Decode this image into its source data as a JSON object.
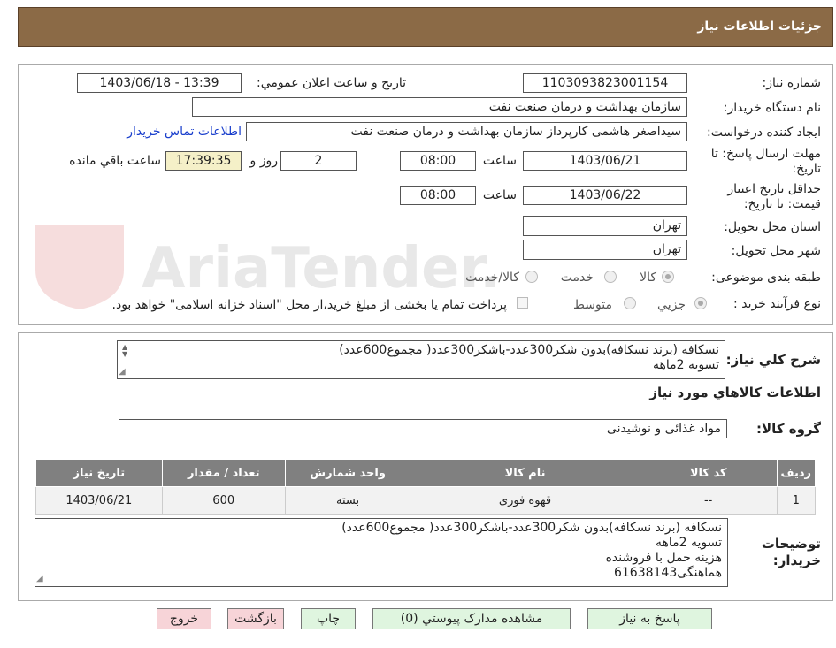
{
  "header": {
    "title": "جزئیات اطلاعات نیاز"
  },
  "form": {
    "need_number_label": "شماره نیاز:",
    "need_number": "1103093823001154",
    "announce_label": "تاریخ و ساعت اعلان عمومي:",
    "announce_value": "1403/06/18 - 13:39",
    "buyer_org_label": "نام دستگاه خریدار:",
    "buyer_org": "سازمان بهداشت و درمان صنعت نفت",
    "requester_label": "ایجاد کننده درخواست:",
    "requester": "سیداصغر هاشمی کارپرداز سازمان بهداشت و درمان صنعت نفت",
    "contact_link": "اطلاعات تماس خریدار",
    "deadline_label_1": "مهلت ارسال پاسخ: تا",
    "deadline_label_2": "تاریخ:",
    "deadline_date": "1403/06/21",
    "time_label": "ساعت",
    "deadline_time": "08:00",
    "days_value": "2",
    "days_label": "روز و",
    "remaining_time": "17:39:35",
    "remaining_label": "ساعت باقي مانده",
    "validity_label_1": "حداقل تاریخ اعتبار",
    "validity_label_2": "قیمت: تا تاریخ:",
    "validity_date": "1403/06/22",
    "validity_time": "08:00",
    "province_label": "استان محل تحویل:",
    "province": "تهران",
    "city_label": "شهر محل تحویل:",
    "city": "تهران",
    "category_label": "طبقه بندی موضوعی:",
    "category_options": [
      "کالا",
      "خدمت",
      "کالا/خدمت"
    ],
    "process_label": "نوع فرآیند خرید :",
    "process_options": [
      "جزیي",
      "متوسط"
    ],
    "payment_note": "پرداخت تمام یا بخشی از مبلغ خرید،از محل \"اسناد خزانه اسلامی\" خواهد بود."
  },
  "summary": {
    "label": "شرح کلي نياز:",
    "lines": [
      "نسکافه (برند نسکافه)بدون شکر300عدد-باشکر300عدد( مجموع600عدد)",
      "تسویه 2ماهه"
    ]
  },
  "goods": {
    "section_title": "اطلاعات کالاهاي مورد نياز",
    "group_label": "گروه کالا:",
    "group_value": "مواد غذائی و نوشیدنی",
    "columns": [
      "ردیف",
      "کد کالا",
      "نام کالا",
      "واحد شمارش",
      "تعداد / مقدار",
      "تاریخ نیاز"
    ],
    "rows": [
      {
        "idx": "1",
        "code": "--",
        "name": "قهوه فوری",
        "unit": "بسته",
        "qty": "600",
        "date": "1403/06/21"
      }
    ]
  },
  "notes": {
    "label_1": "توضیحات",
    "label_2": "خریدار:",
    "lines": [
      "نسکافه (برند نسکافه)بدون شکر300عدد-باشکر300عدد( مجموع600عدد)",
      "تسویه 2ماهه",
      "هزینه حمل با فروشنده",
      "هماهنگی61638143"
    ]
  },
  "buttons": {
    "reply": "پاسخ به نياز",
    "attachments": "مشاهده مدارک پيوستي (0)",
    "print": "چاپ",
    "back": "بازگشت",
    "exit": "خروج"
  },
  "watermark": {
    "text": "AriaTender.neT"
  },
  "colors": {
    "header": "#8b6a46",
    "link": "#1a3fcc",
    "remaining_bg": "#f5f0c8",
    "table_header": "#808080"
  }
}
